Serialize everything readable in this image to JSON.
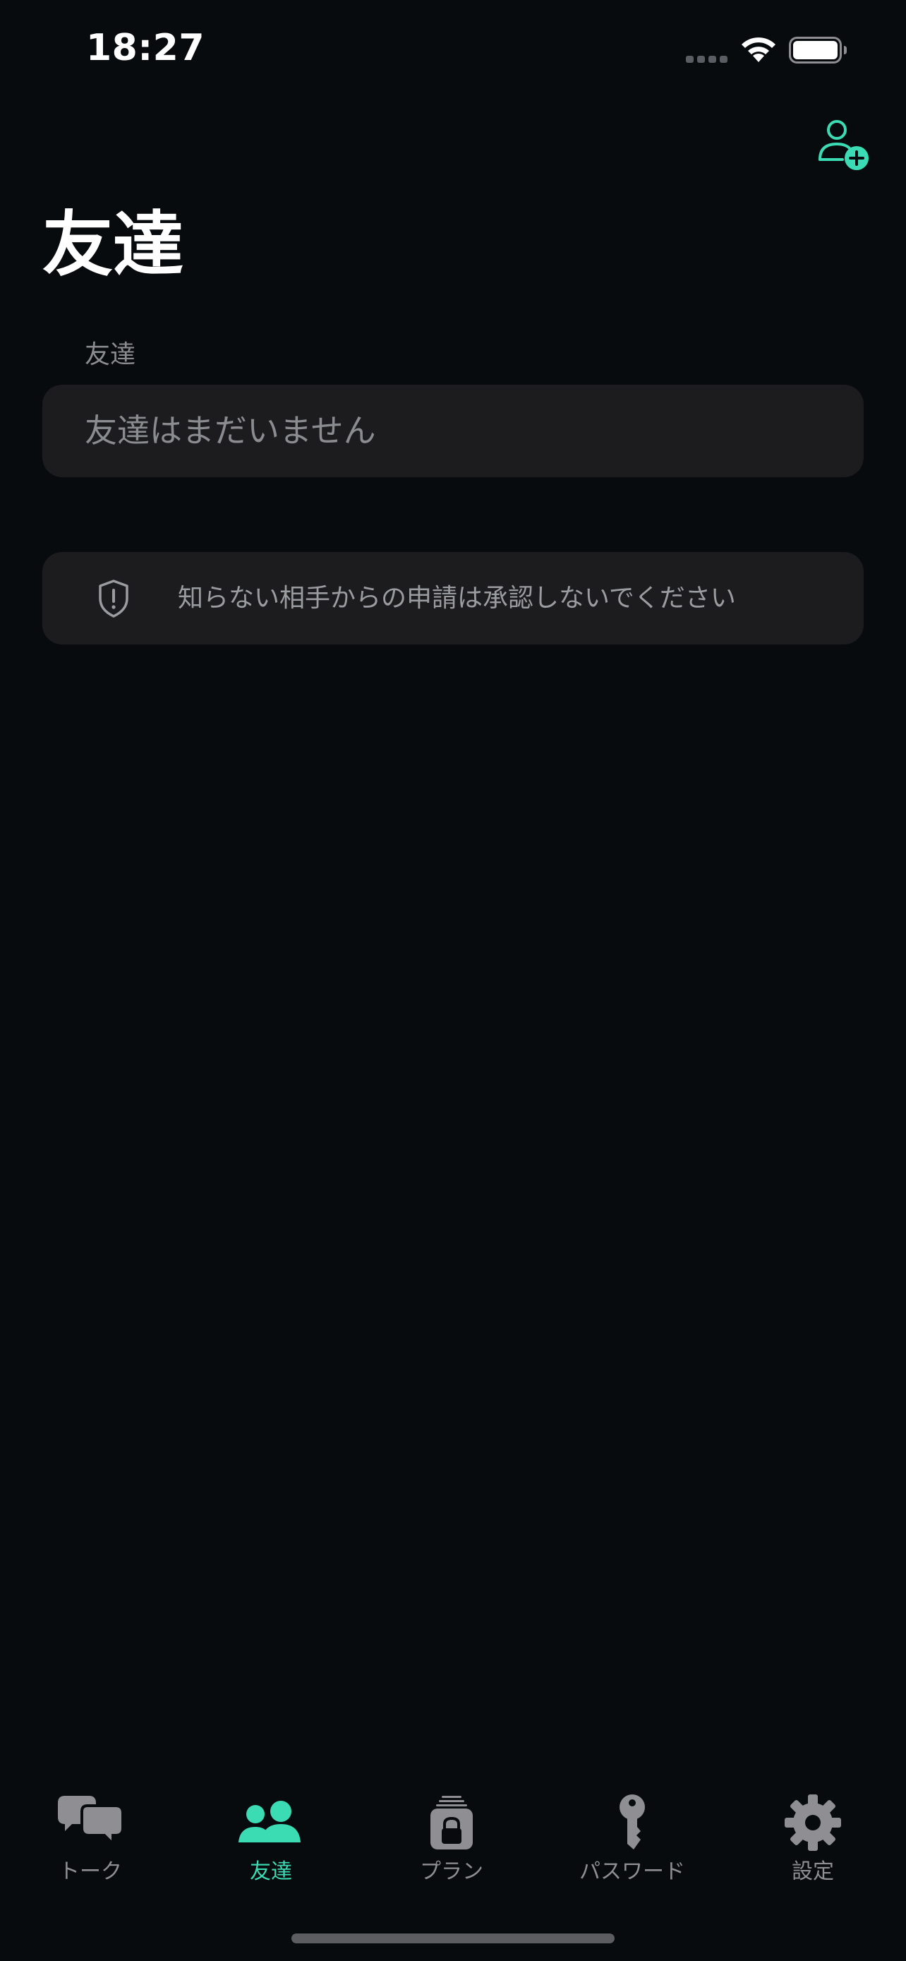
{
  "status_bar": {
    "time": "18:27"
  },
  "header": {
    "title": "友達",
    "add_friend_icon": "person-add-icon"
  },
  "friends_section": {
    "header": "友達",
    "empty_text": "友達はまだいません"
  },
  "warning": {
    "icon": "shield-exclamation-icon",
    "text": "知らない相手からの申請は承認しないでください"
  },
  "tabs": [
    {
      "label": "トーク",
      "icon": "chat-bubbles-icon",
      "active": false
    },
    {
      "label": "友達",
      "icon": "people-icon",
      "active": true
    },
    {
      "label": "プラン",
      "icon": "lock-stack-icon",
      "active": false
    },
    {
      "label": "パスワード",
      "icon": "key-icon",
      "active": false
    },
    {
      "label": "設定",
      "icon": "gear-icon",
      "active": false
    }
  ],
  "colors": {
    "background": "#080b0e",
    "card": "#1c1c1e",
    "accent": "#3bdcb4",
    "inactive": "#8e8e93"
  }
}
